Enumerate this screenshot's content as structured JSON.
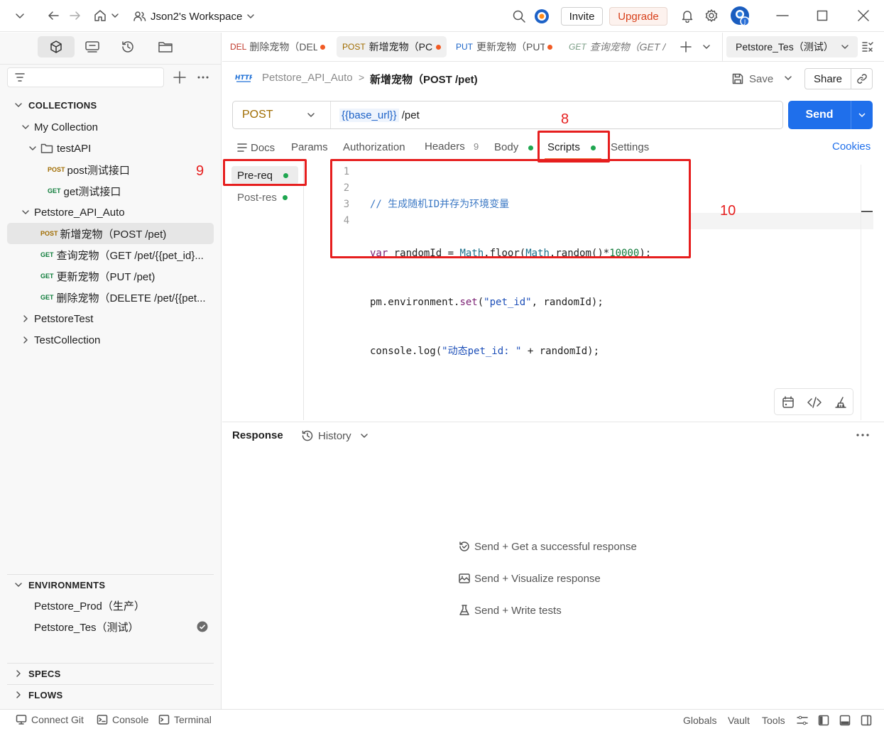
{
  "titlebar": {
    "workspace": "Json2's Workspace",
    "invite": "Invite",
    "upgrade": "Upgrade"
  },
  "sidebar": {
    "collections_header": "COLLECTIONS",
    "my_collection": "My Collection",
    "testapi_folder": "testAPI",
    "testapi_items": [
      {
        "method": "POST",
        "name": "post测试接口"
      },
      {
        "method": "GET",
        "name": "get测试接口"
      }
    ],
    "petstore_auto": "Petstore_API_Auto",
    "petstore_items": [
      {
        "method": "POST",
        "name": "新增宠物（POST /pet)"
      },
      {
        "method": "GET",
        "name": "查询宠物（GET /pet/{{pet_id}..."
      },
      {
        "method": "GET",
        "name": "更新宠物（PUT /pet)"
      },
      {
        "method": "GET",
        "name": "删除宠物（DELETE /pet/{{pet..."
      }
    ],
    "petstore_test": "PetstoreTest",
    "test_collection": "TestCollection",
    "environments_header": "ENVIRONMENTS",
    "environments": [
      "Petstore_Prod（生产）",
      "Petstore_Tes（测试）"
    ],
    "specs_header": "SPECS",
    "flows_header": "FLOWS"
  },
  "tabs": [
    {
      "method": "DEL",
      "name": "删除宠物（DEL"
    },
    {
      "method": "POST",
      "name": "新增宠物（PC"
    },
    {
      "method": "PUT",
      "name": "更新宠物（PUT"
    },
    {
      "method": "GET",
      "name": "查询宠物（GET /"
    }
  ],
  "env_selector": "Petstore_Tes（测试）",
  "breadcrumb": {
    "collection": "Petstore_API_Auto",
    "separator": ">",
    "request": "新增宠物（POST /pet)"
  },
  "actions": {
    "save": "Save",
    "share": "Share",
    "send": "Send"
  },
  "request": {
    "method": "POST",
    "url_var": "{{base_url}}",
    "url_path": " /pet"
  },
  "req_tabs": {
    "docs": "Docs",
    "params": "Params",
    "authorization": "Authorization",
    "headers": "Headers",
    "headers_count": "9",
    "body": "Body",
    "scripts": "Scripts",
    "settings": "Settings",
    "cookies": "Cookies"
  },
  "script_tabs": {
    "pre_req": "Pre-req",
    "post_res": "Post-res"
  },
  "code": {
    "line_numbers": [
      "1",
      "2",
      "3",
      "4"
    ],
    "line1": "// 生成随机ID并存为环境变量",
    "line2": {
      "kw": "var",
      "a": " randomId = ",
      "obj1": "Math",
      "b": ".floor(",
      "obj2": "Math",
      "c": ".random()*",
      "num": "10000",
      "d": ");"
    },
    "line3": {
      "a": "pm.environment.",
      "fn": "set",
      "b": "(",
      "str": "\"pet_id\"",
      "c": ", randomId);"
    },
    "line4": {
      "a": "console.log(",
      "str": "\"动态pet_id: \"",
      "b": " + randomId);"
    }
  },
  "annotations": {
    "n8": "8",
    "n9": "9",
    "n10": "10"
  },
  "response": {
    "title": "Response",
    "history": "History",
    "hints": [
      "Send + Get a successful response",
      "Send + Visualize response",
      "Send + Write tests"
    ]
  },
  "statusbar": {
    "connect_git": "Connect Git",
    "console": "Console",
    "terminal": "Terminal",
    "globals": "Globals",
    "vault": "Vault",
    "tools": "Tools"
  }
}
